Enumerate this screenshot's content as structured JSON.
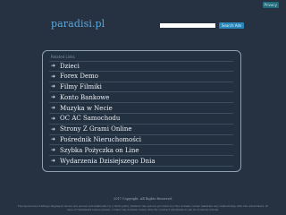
{
  "header": {
    "privacy_label": "Privacy",
    "logo": "paradisi.pl",
    "search_placeholder": "",
    "search_button": "Search Ads"
  },
  "related": {
    "heading": "Related Links",
    "links": [
      {
        "label": "Dzieci"
      },
      {
        "label": "Forex Demo"
      },
      {
        "label": "Filmy Filmiki"
      },
      {
        "label": "Konto Bankowe"
      },
      {
        "label": "Muzyka w Necie"
      },
      {
        "label": "OC AC Samochodu"
      },
      {
        "label": "Strony Z Grami Online"
      },
      {
        "label": "Pośrednik Nieruchomości"
      },
      {
        "label": "Szybka Pożyczka on Line"
      },
      {
        "label": "Wydarzenia Dzisiejszego Dnia"
      }
    ]
  },
  "footer": {
    "copyright": "2017 Copyright. All Rights Reserved.",
    "disclaimer": "The Sponsored Listings displayed above are served automatically by a third party. Neither the service provider nor the domain owner maintain any relationship with the advertisers. In case of trademark issues please contact the domain owner directly (contact information can be found in whois)."
  },
  "colors": {
    "background": "#263241",
    "logo": "#5aa8dc",
    "button": "#2a86b8",
    "link_text": "#e9eef3"
  }
}
